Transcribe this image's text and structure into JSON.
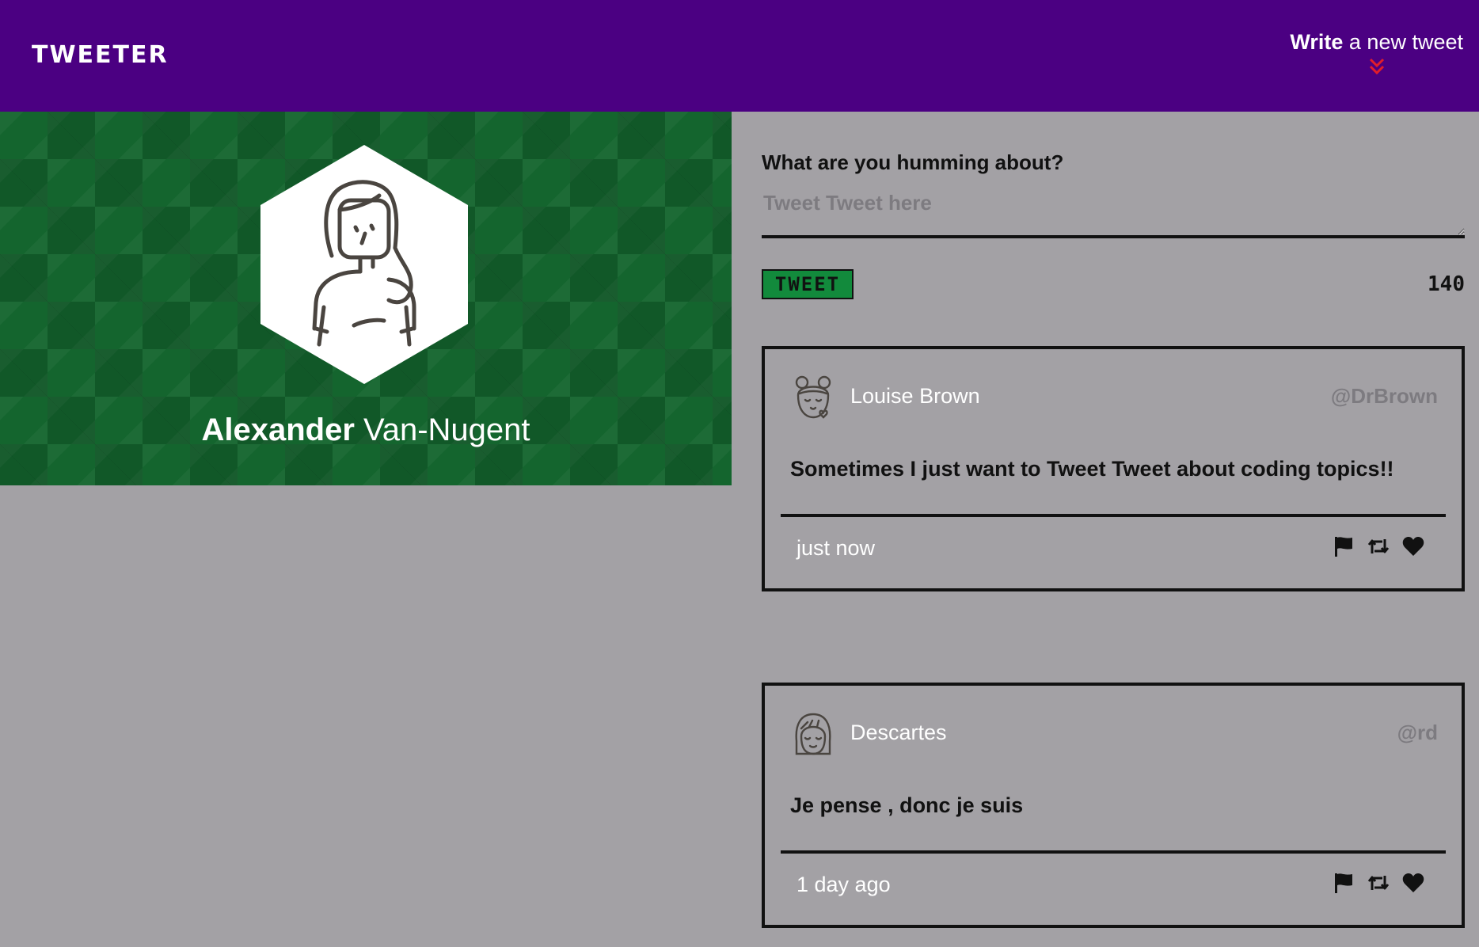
{
  "nav": {
    "brand": "TWEETER",
    "write_bold": "Write",
    "write_rest": " a new tweet",
    "chevron_icon": "double-chevron-down",
    "chevron_color": "#e11d2a",
    "background": "#4b0082"
  },
  "profile": {
    "first_name": "Alexander",
    "last_name": " Van-Nugent",
    "avatar_icon": "woman-avatar",
    "background": "#14652e"
  },
  "compose": {
    "label": "What are you humming about?",
    "placeholder": "Tweet Tweet here",
    "value": "",
    "button_label": "TWEET",
    "button_color": "#128a3c",
    "counter": "140"
  },
  "tweets": [
    {
      "avatar_icon": "girl-with-buns-avatar",
      "name": "Louise Brown",
      "handle": "@DrBrown",
      "content": "Sometimes I just want to Tweet Tweet about coding topics!!",
      "time": "just now",
      "actions": [
        "flag-icon",
        "retweet-icon",
        "heart-icon"
      ]
    },
    {
      "avatar_icon": "girl-with-bangs-avatar",
      "name": "Descartes",
      "handle": "@rd",
      "content": "Je pense , donc je suis",
      "time": "1 day ago",
      "actions": [
        "flag-icon",
        "retweet-icon",
        "heart-icon"
      ]
    }
  ]
}
